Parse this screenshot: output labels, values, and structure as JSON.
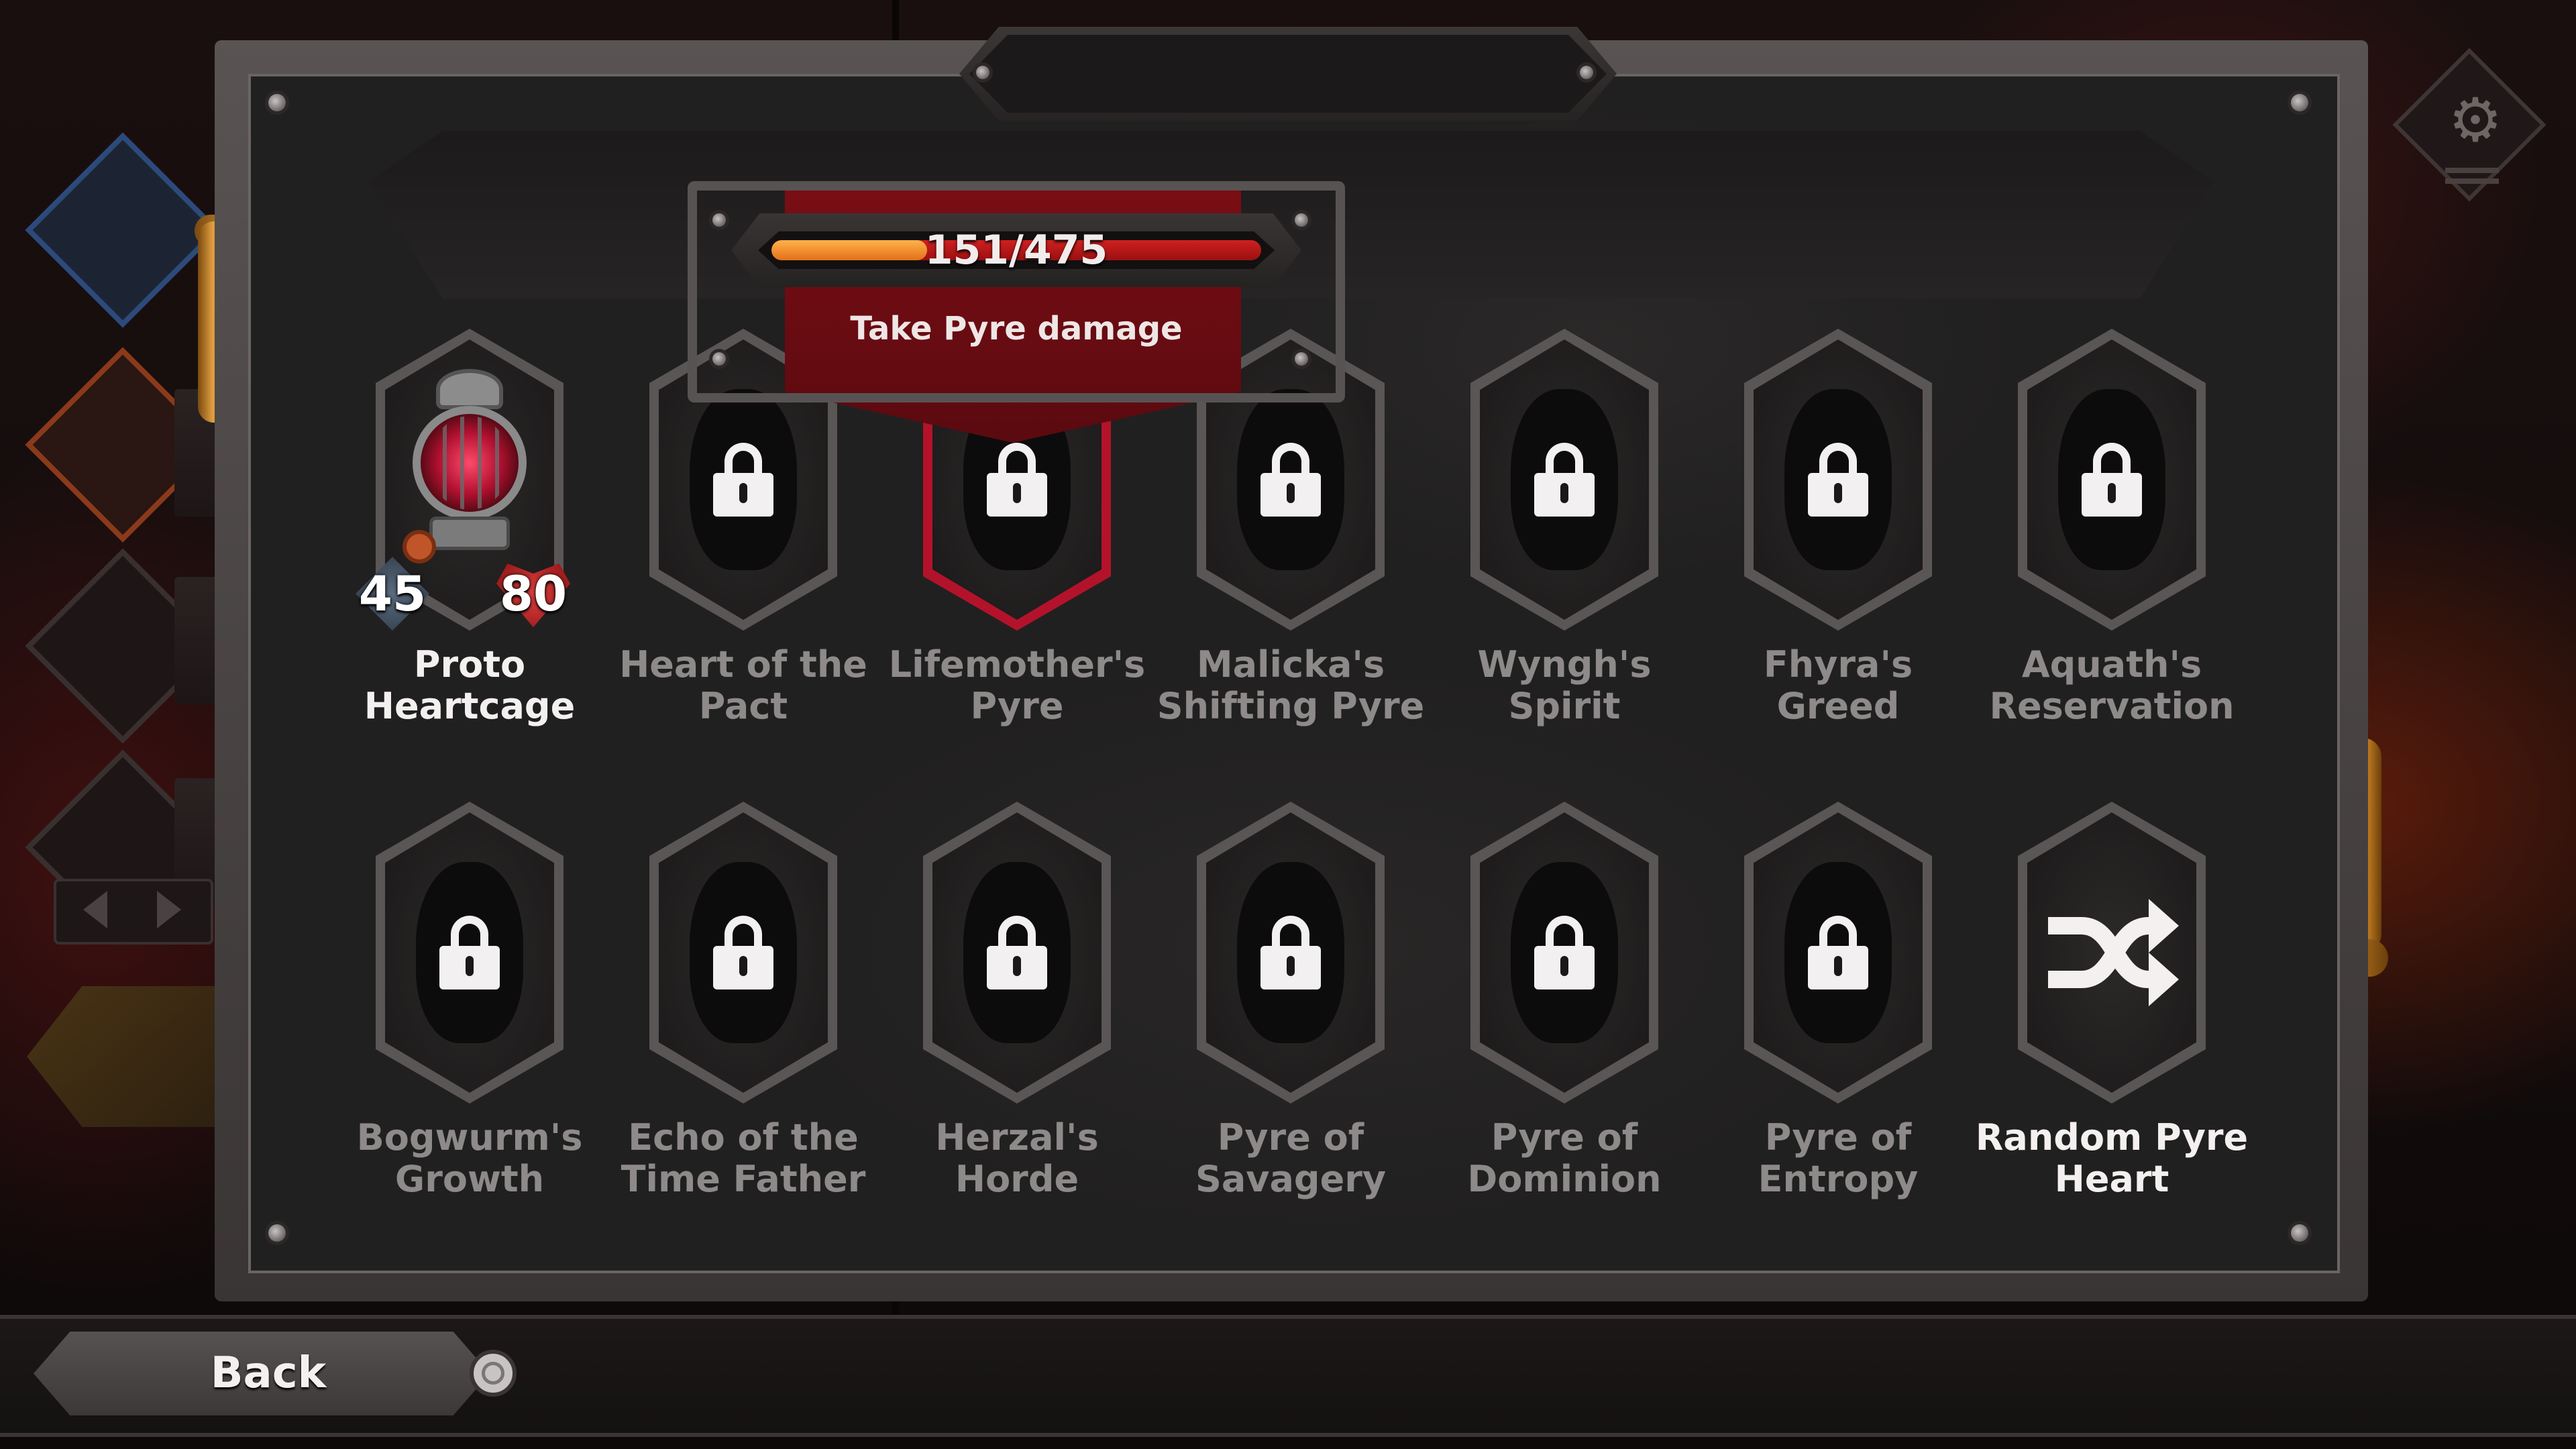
{
  "progress": {
    "current": 151,
    "max": 475,
    "text": "151/475",
    "fill_fraction": 0.318,
    "objective": "Take Pyre damage"
  },
  "hearts": [
    {
      "name": "Proto Heartcage",
      "locked": false,
      "attack": "45",
      "health": "80"
    },
    {
      "name": "Heart of the Pact",
      "locked": true
    },
    {
      "name": "Lifemother's Pyre",
      "locked": true,
      "selected": true
    },
    {
      "name": "Malicka's Shifting Pyre",
      "locked": true
    },
    {
      "name": "Wyngh's Spirit",
      "locked": true
    },
    {
      "name": "Fhyra's Greed",
      "locked": true
    },
    {
      "name": "Aquath's Reservation",
      "locked": true
    },
    {
      "name": "Bogwurm's Growth",
      "locked": true
    },
    {
      "name": "Echo of the Time Father",
      "locked": true
    },
    {
      "name": "Herzal's Horde",
      "locked": true
    },
    {
      "name": "Pyre of Savagery",
      "locked": true
    },
    {
      "name": "Pyre of Dominion",
      "locked": true
    },
    {
      "name": "Pyre of Entropy",
      "locked": true
    },
    {
      "name": "Random Pyre Heart",
      "locked": false
    }
  ],
  "footer": {
    "back_label": "Back"
  },
  "icons": {
    "settings": "gear-icon",
    "lock": "lock-icon",
    "random": "shuffle-icon",
    "confirm": "circle-button-icon"
  },
  "colors": {
    "progress_fill": "#f08a2a",
    "progress_track": "#c01818",
    "selected_border": "#b3132a",
    "banner": "#6e0c12"
  }
}
